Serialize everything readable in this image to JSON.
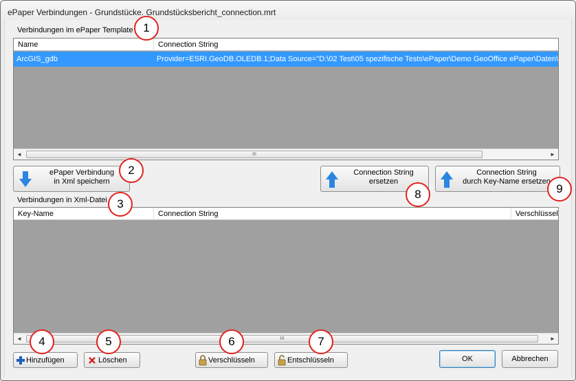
{
  "window": {
    "title": "ePaper Verbindungen - Grundstücke. Grundstücksbericht_connection.mrt"
  },
  "template_section": {
    "label": "Verbindungen im ePaper Template",
    "columns": [
      "Name",
      "Connection String"
    ],
    "rows": [
      {
        "name": "ArcGIS_gdb",
        "connection_string": "Provider=ESRI.GeoDB.OLEDB.1;Data Source=\"D:\\02 Test\\05 spezifische Tests\\ePaper\\Demo GeoOffice ePaper\\Daten\\G"
      }
    ],
    "selected_row": 0
  },
  "xml_section": {
    "label": "Verbindungen in Xml-Datei",
    "columns": [
      "Key-Name",
      "Connection String",
      "Verschlüsselt"
    ],
    "rows": []
  },
  "buttons": {
    "save_xml": [
      "ePaper Verbindung",
      "in Xml speichern"
    ],
    "replace_cs": [
      "Connection String",
      "ersetzen"
    ],
    "replace_cs_key": [
      "Connection String",
      "durch Key-Name ersetzen"
    ],
    "add": "Hinzufügen",
    "delete": "Löschen",
    "encrypt": "Verschlüsseln",
    "decrypt": "Entschlüsseln",
    "ok": "OK",
    "cancel": "Abbrechen"
  },
  "scrollbar": {
    "left_arrow": "◄",
    "right_arrow": "►",
    "grip": "III"
  },
  "callouts": [
    "1",
    "2",
    "3",
    "4",
    "5",
    "6",
    "7",
    "8",
    "9"
  ],
  "colors": {
    "selection": "#3399ff",
    "grid_bg": "#a0a0a0",
    "callout_border": "#e0211e",
    "arrow_blue": "#2a86e0",
    "add_blue": "#1f5fbf",
    "delete_red": "#d42020"
  },
  "icons": {
    "save_xml": "arrow-down-icon",
    "replace": "arrow-up-icon",
    "add": "plus-icon",
    "delete": "x-icon",
    "encrypt": "lock-icon",
    "decrypt": "unlock-icon"
  }
}
